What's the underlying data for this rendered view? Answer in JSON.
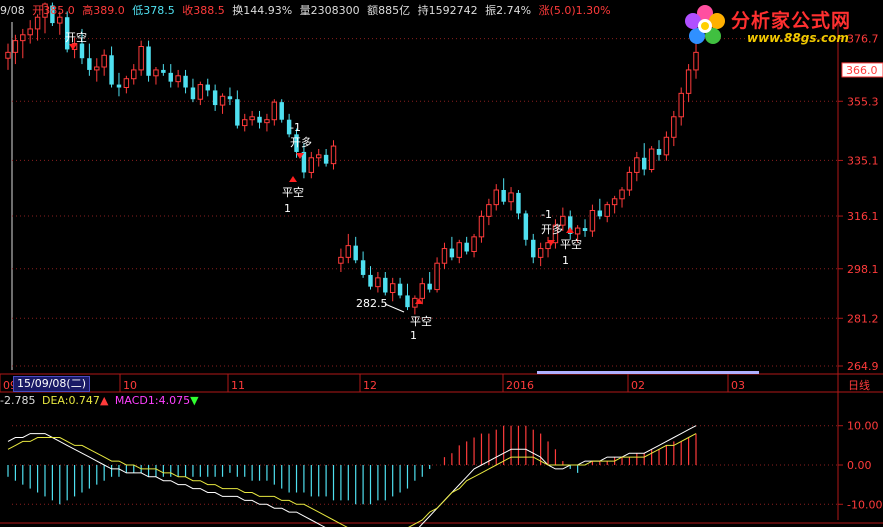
{
  "quote_bar": {
    "date": "9/08",
    "open_label": "开",
    "open": "385.0",
    "high_label": "高",
    "high": "389.0",
    "low_label": "低",
    "low": "378.5",
    "close_label": "收",
    "close": "388.5",
    "turnover_label": "换",
    "turnover": "144.93%",
    "volume_label": "量",
    "volume": "2308300",
    "amount_label": "额",
    "amount": "885亿",
    "hold_label": "持",
    "hold": "1592742",
    "amplitude_label": "振",
    "amplitude": "2.74%",
    "change_label": "涨",
    "change": "(5.0)1.30%"
  },
  "logo": {
    "title": "分析家公式网",
    "url": "www.88gs.com"
  },
  "colors": {
    "up": "#ff3b3b",
    "down": "#4fe0f0",
    "grid": "#8a1f1f",
    "axis": "#b01818"
  },
  "price_axis": {
    "ticks": [
      "376.7",
      "355.3",
      "335.1",
      "316.1",
      "298.1",
      "281.2",
      "264.9"
    ],
    "current": "366.0"
  },
  "time_axis": {
    "labels": [
      "09",
      "10",
      "11",
      "12",
      "2016",
      "02",
      "03"
    ],
    "selected_date": "15/09/08(二)",
    "period": "日线"
  },
  "annotations": {
    "open_top": "开空",
    "signal_a": "-1",
    "signal_b": "开多",
    "signal_c": "平空",
    "signal_d": "1",
    "low_price": "282.5"
  },
  "macd_bar": {
    "dif": "-2.785",
    "dea_label": "DEA:",
    "dea": "0.747",
    "macd_label": "MACD1:",
    "macd": "4.075"
  },
  "macd_axis": {
    "ticks": [
      "10.00",
      "0.00",
      "-10.00"
    ]
  },
  "chart_data": {
    "type": "candlestick",
    "ylim": [
      264.9,
      381
    ],
    "candles": [
      [
        370,
        375,
        366,
        372
      ],
      [
        372,
        378,
        368,
        376
      ],
      [
        376,
        380,
        370,
        378
      ],
      [
        378,
        383,
        375,
        380
      ],
      [
        380,
        385,
        376,
        384
      ],
      [
        384,
        389,
        378.5,
        388.5
      ],
      [
        388,
        389,
        381,
        382
      ],
      [
        382,
        386,
        378,
        384
      ],
      [
        384,
        386,
        372,
        373
      ],
      [
        373,
        377,
        370,
        375
      ],
      [
        375,
        380,
        368,
        370
      ],
      [
        370,
        375,
        364,
        366
      ],
      [
        366,
        370,
        362,
        367
      ],
      [
        367,
        373,
        364,
        371
      ],
      [
        371,
        374,
        360,
        361
      ],
      [
        361,
        365,
        357,
        360
      ],
      [
        360,
        364,
        358,
        363
      ],
      [
        363,
        368,
        361,
        366
      ],
      [
        366,
        376,
        364,
        374
      ],
      [
        374,
        376,
        362,
        364
      ],
      [
        364,
        367,
        361,
        366
      ],
      [
        366,
        368,
        364,
        365
      ],
      [
        365,
        368,
        360,
        362
      ],
      [
        362,
        366,
        360,
        364
      ],
      [
        364,
        366,
        358,
        360
      ],
      [
        360,
        363,
        355,
        356
      ],
      [
        356,
        362,
        354,
        361
      ],
      [
        361,
        363,
        357,
        359
      ],
      [
        359,
        361,
        352,
        354
      ],
      [
        354,
        358,
        351,
        357
      ],
      [
        357,
        360,
        354,
        356
      ],
      [
        356,
        359,
        346,
        347
      ],
      [
        347,
        351,
        345,
        349
      ],
      [
        349,
        352,
        347,
        350
      ],
      [
        350,
        352,
        346,
        348
      ],
      [
        348,
        351,
        345,
        349
      ],
      [
        349,
        356,
        347,
        355
      ],
      [
        355,
        356,
        348,
        349
      ],
      [
        349,
        351,
        343,
        344
      ],
      [
        344,
        346,
        336,
        338
      ],
      [
        338,
        341,
        329,
        331
      ],
      [
        331,
        338,
        329,
        336
      ],
      [
        336,
        339,
        333,
        337
      ],
      [
        337,
        339,
        333,
        334
      ],
      [
        334,
        342,
        332,
        340
      ],
      [
        300,
        305,
        297,
        302
      ],
      [
        302,
        310,
        300,
        306
      ],
      [
        306,
        309,
        300,
        301
      ],
      [
        301,
        304,
        295,
        296
      ],
      [
        296,
        299,
        291,
        292
      ],
      [
        292,
        297,
        290,
        295
      ],
      [
        295,
        297,
        289,
        290
      ],
      [
        290,
        295,
        287,
        293
      ],
      [
        293,
        295,
        288,
        289
      ],
      [
        289,
        293,
        284,
        285
      ],
      [
        285,
        289,
        282.5,
        288
      ],
      [
        288,
        295,
        286,
        293
      ],
      [
        293,
        297,
        290,
        291
      ],
      [
        291,
        302,
        290,
        300
      ],
      [
        300,
        307,
        298,
        305
      ],
      [
        305,
        309,
        301,
        302
      ],
      [
        302,
        308,
        300,
        307
      ],
      [
        307,
        309,
        303,
        304
      ],
      [
        304,
        310,
        302,
        309
      ],
      [
        309,
        318,
        307,
        316
      ],
      [
        316,
        322,
        313,
        320
      ],
      [
        320,
        327,
        318,
        325
      ],
      [
        325,
        329,
        320,
        321
      ],
      [
        321,
        326,
        318,
        324
      ],
      [
        324,
        325,
        315,
        317
      ],
      [
        317,
        318,
        306,
        308
      ],
      [
        308,
        310,
        300,
        302
      ],
      [
        302,
        307,
        299,
        305
      ],
      [
        305,
        309,
        302,
        307
      ],
      [
        307,
        315,
        305,
        313
      ],
      [
        313,
        319,
        311,
        316
      ],
      [
        316,
        318,
        308,
        310
      ],
      [
        310,
        313,
        307,
        312
      ],
      [
        312,
        315,
        309,
        311
      ],
      [
        311,
        320,
        309,
        318
      ],
      [
        318,
        322,
        315,
        316
      ],
      [
        316,
        321,
        314,
        320
      ],
      [
        320,
        323,
        317,
        322
      ],
      [
        322,
        326,
        319,
        325
      ],
      [
        325,
        333,
        323,
        331
      ],
      [
        331,
        338,
        328,
        336
      ],
      [
        336,
        341,
        330,
        332
      ],
      [
        332,
        340,
        331,
        339
      ],
      [
        339,
        342,
        335,
        337
      ],
      [
        337,
        345,
        335,
        343
      ],
      [
        343,
        352,
        340,
        350
      ],
      [
        350,
        360,
        347,
        358
      ],
      [
        358,
        368,
        355,
        366
      ],
      [
        366,
        376.7,
        363,
        372
      ]
    ],
    "macd": [
      -3,
      -4,
      -5,
      -6,
      -7,
      -8,
      -9,
      -10,
      -9,
      -8,
      -7,
      -6,
      -5,
      -4,
      -3,
      -3,
      -2,
      -2,
      -2,
      -3,
      -3,
      -3,
      -3,
      -3,
      -3,
      -3,
      -3,
      -3,
      -3,
      -3,
      -2,
      -3,
      -3,
      -4,
      -4,
      -4,
      -5,
      -6,
      -7,
      -7,
      -7,
      -8,
      -8,
      -8,
      -9,
      -9,
      -9,
      -10,
      -10,
      -10,
      -9,
      -9,
      -8,
      -7,
      -6,
      -4,
      -3,
      -1,
      0,
      2,
      3,
      5,
      6,
      7,
      8,
      8,
      9,
      10,
      10,
      10,
      10,
      9,
      8,
      6,
      4,
      1,
      -1,
      -2,
      0,
      1,
      1,
      1,
      2,
      2,
      2,
      3,
      3,
      4,
      4,
      5,
      6,
      6,
      7,
      8
    ],
    "dif": [
      6,
      7,
      7,
      8,
      8,
      8,
      7,
      6,
      5,
      4,
      3,
      2,
      1,
      0,
      -1,
      -1,
      -2,
      -2,
      -2,
      -3,
      -3,
      -4,
      -4,
      -5,
      -5,
      -6,
      -6,
      -7,
      -7,
      -8,
      -8,
      -8,
      -9,
      -9,
      -10,
      -10,
      -11,
      -11,
      -12,
      -12,
      -13,
      -14,
      -15,
      -16,
      -17,
      -18,
      -19,
      -20,
      -21,
      -21,
      -21,
      -21,
      -20,
      -19,
      -18,
      -17,
      -15,
      -13,
      -11,
      -9,
      -7,
      -5,
      -3,
      -1,
      0,
      1,
      2,
      3,
      4,
      4,
      4,
      3,
      2,
      0,
      -1,
      -1,
      0,
      0,
      1,
      1,
      1,
      2,
      2,
      2,
      3,
      3,
      3,
      4,
      5,
      6,
      7,
      8,
      9,
      10
    ],
    "dea": [
      4,
      5,
      6,
      6,
      7,
      7,
      7,
      7,
      6,
      5,
      5,
      4,
      3,
      2,
      1,
      1,
      0,
      0,
      -1,
      -1,
      -1,
      -2,
      -2,
      -3,
      -3,
      -4,
      -4,
      -5,
      -5,
      -6,
      -6,
      -6,
      -7,
      -7,
      -8,
      -8,
      -8,
      -9,
      -9,
      -10,
      -10,
      -11,
      -12,
      -13,
      -14,
      -15,
      -16,
      -17,
      -17,
      -18,
      -18,
      -18,
      -18,
      -17,
      -16,
      -15,
      -14,
      -12,
      -11,
      -9,
      -7,
      -6,
      -4,
      -3,
      -2,
      -1,
      0,
      1,
      2,
      2,
      2,
      2,
      1,
      0,
      0,
      0,
      0,
      0,
      0,
      1,
      1,
      1,
      1,
      2,
      2,
      2,
      2,
      3,
      4,
      5,
      5,
      6,
      7,
      8
    ]
  }
}
